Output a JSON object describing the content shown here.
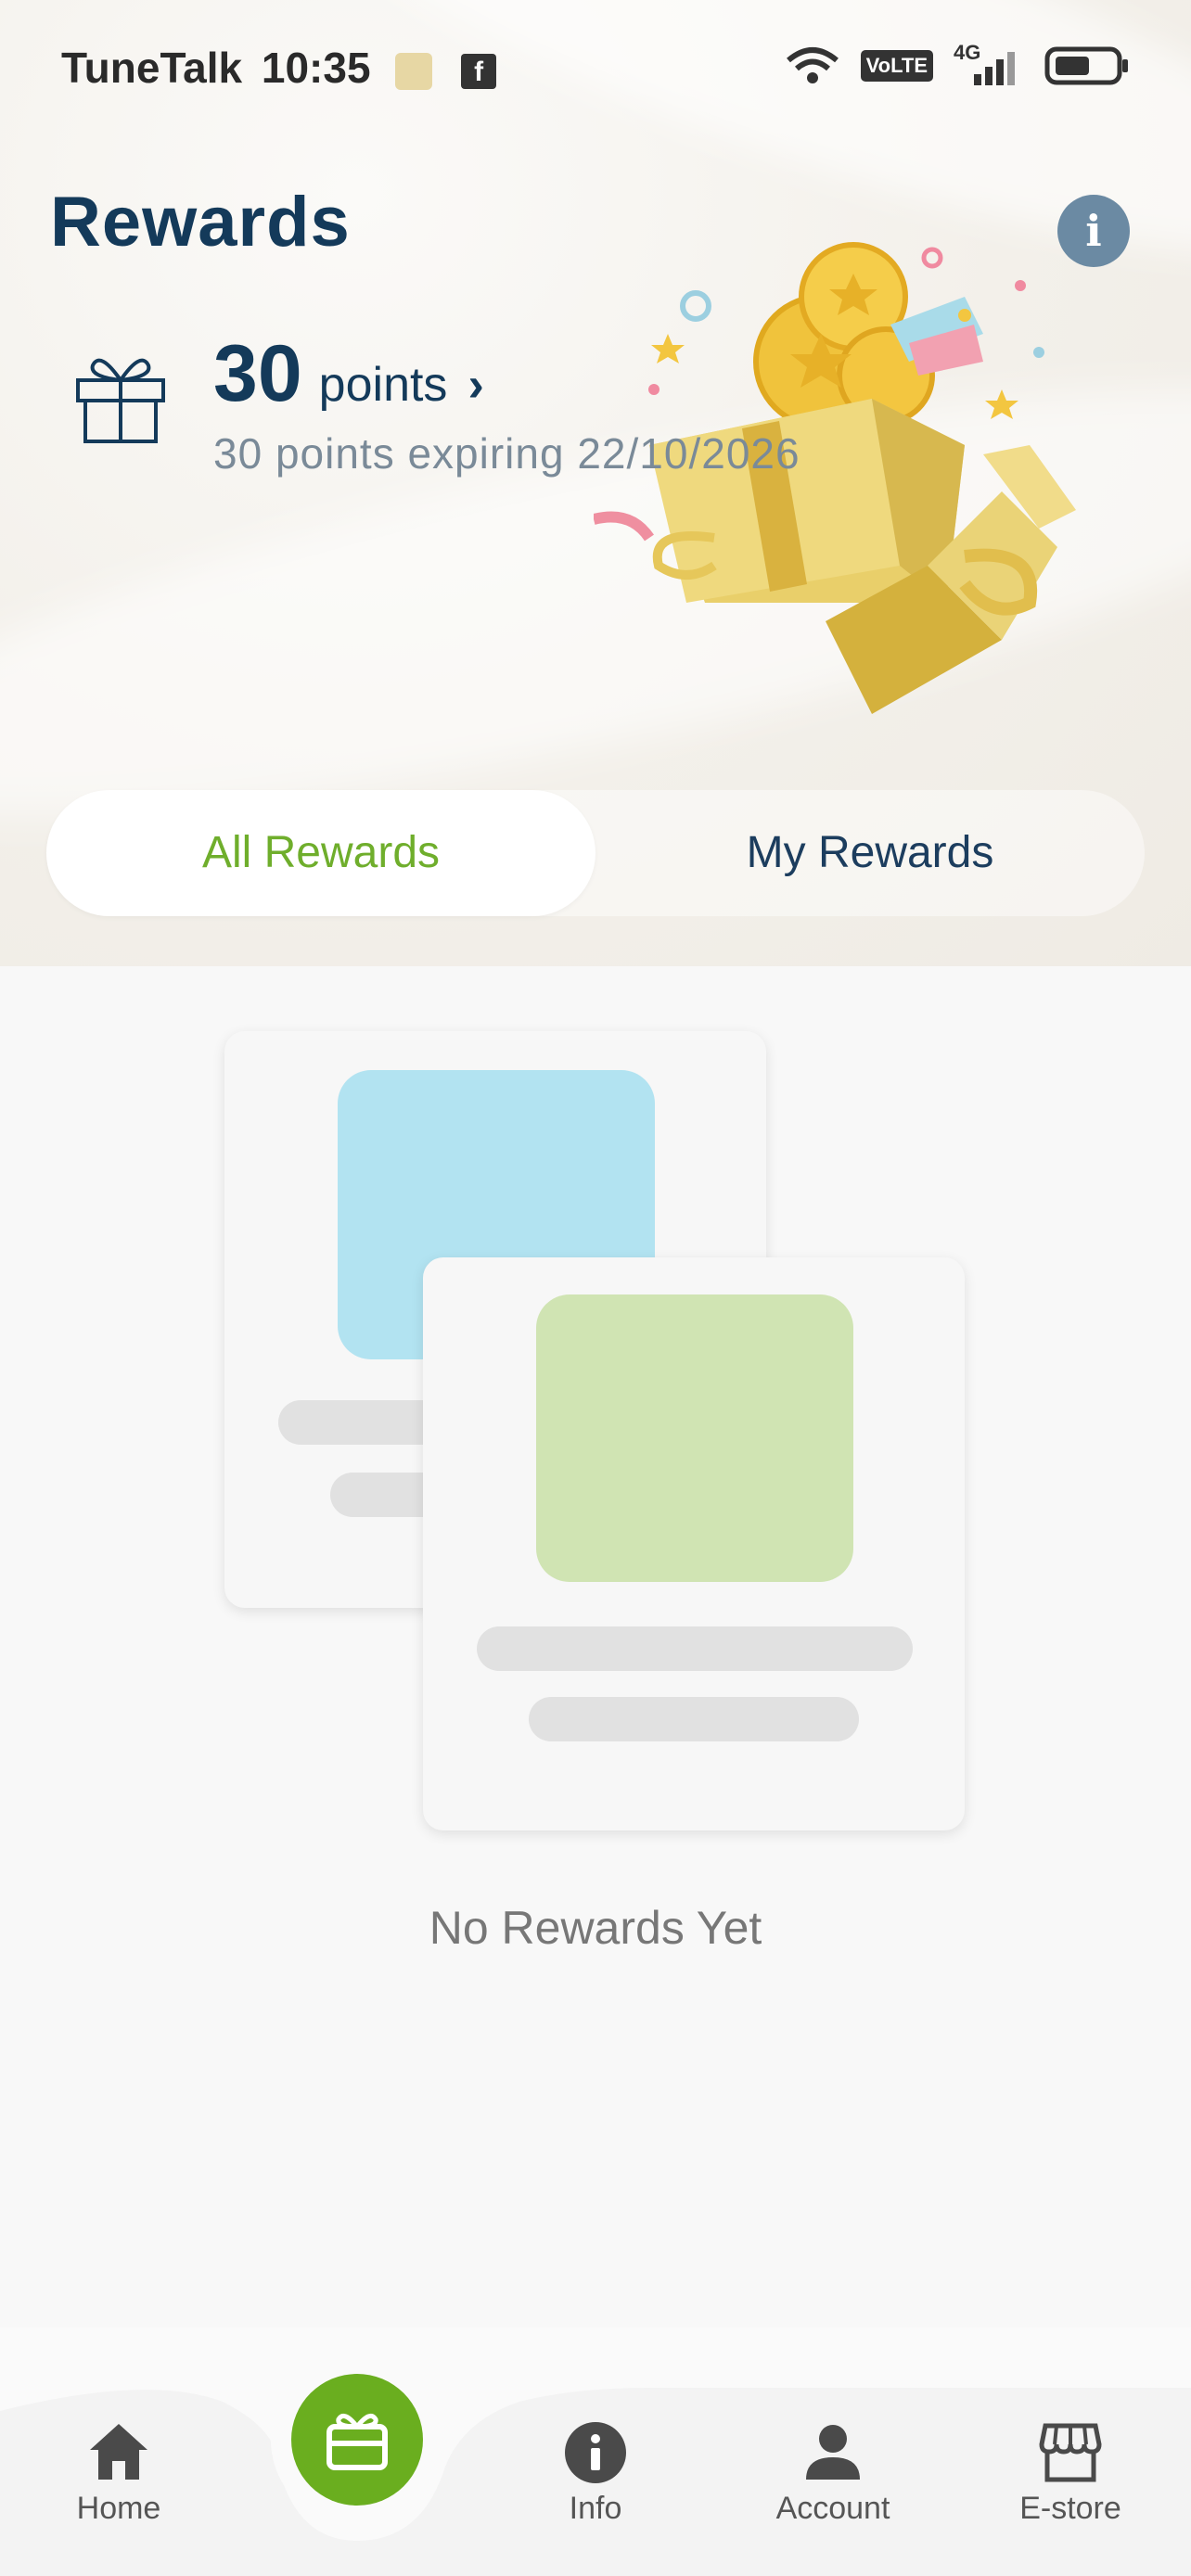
{
  "status_bar": {
    "carrier": "TuneTalk",
    "time": "10:35",
    "network": "4G",
    "volte": "VoLTE"
  },
  "header": {
    "title": "Rewards"
  },
  "points": {
    "value": "30",
    "unit": "points",
    "expiry": "30 points expiring 22/10/2026"
  },
  "tabs": [
    {
      "label": "All Rewards",
      "active": true
    },
    {
      "label": "My Rewards",
      "active": false
    }
  ],
  "empty_state": {
    "text": "No Rewards Yet"
  },
  "bottom_nav": [
    {
      "label": "Home",
      "icon": "home-icon"
    },
    {
      "label": "",
      "icon": "rewards-icon"
    },
    {
      "label": "Info",
      "icon": "info-icon"
    },
    {
      "label": "Account",
      "icon": "account-icon"
    },
    {
      "label": "E-store",
      "icon": "store-icon"
    }
  ],
  "colors": {
    "primary_navy": "#143a5a",
    "accent_green": "#6aae1f",
    "placeholder_blue": "#b2e3f1",
    "placeholder_green": "#d0e4b3"
  }
}
